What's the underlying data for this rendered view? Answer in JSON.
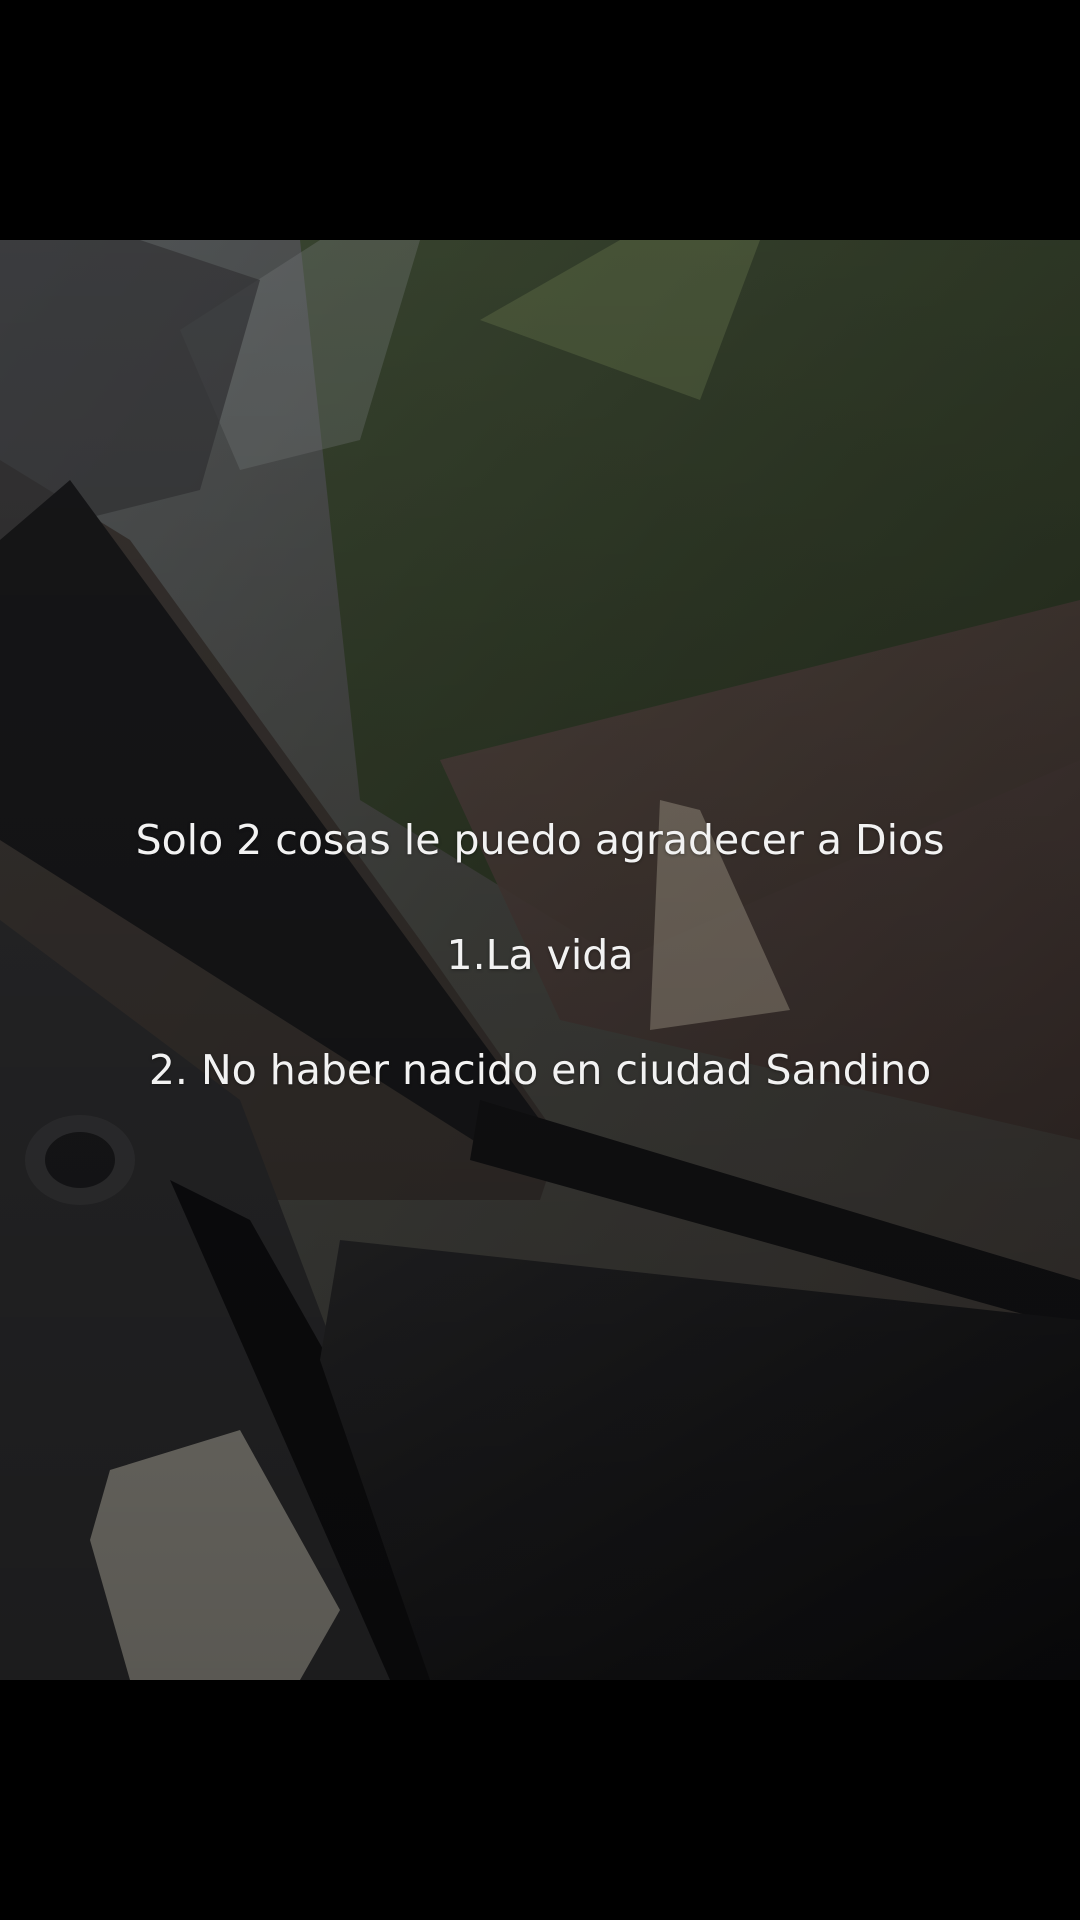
{
  "caption": {
    "line_1": "Solo 2 cosas le puedo agradecer a Dios",
    "line_2": "1.La vida",
    "line_3": "2. No haber nacido en ciudad Sandino"
  },
  "scene": {
    "description_icon": "car-window-video-frame"
  }
}
